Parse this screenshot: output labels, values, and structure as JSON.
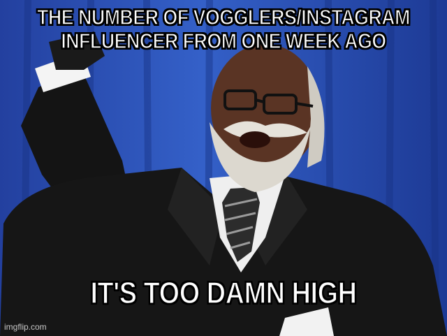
{
  "meme": {
    "top_text_line1": "THE NUMBER OF VOGGLERS/INSTAGRAM",
    "top_text_line2": "INFLUENCER FROM ONE WEEK AGO",
    "bottom_text": "IT'S TOO DAMN HIGH",
    "watermark": "imgflip.com"
  },
  "colors": {
    "background_blue": "#2a4fb5",
    "suit": "#151515",
    "shirt": "#f2f2f2",
    "skin": "#5a3424",
    "beard": "#dcd8cf",
    "caption_fill": "#ffffff",
    "caption_outline": "#000000"
  }
}
